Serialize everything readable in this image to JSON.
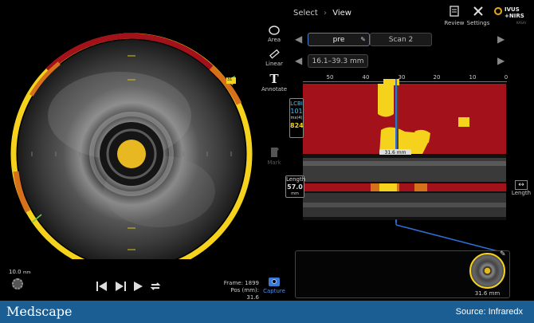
{
  "breadcrumb": {
    "select": "Select",
    "sep": "›",
    "view": "View"
  },
  "top_actions": {
    "review": "Review",
    "settings": "Settings"
  },
  "logo": {
    "line1": "IVUS",
    "line2": "+NIRS",
    "sub": "KASAI"
  },
  "tools": {
    "area": "Area",
    "linear": "Linear",
    "annotate": "Annotate",
    "mark": "Mark"
  },
  "scans": {
    "pre": "pre",
    "scan2": "Scan 2",
    "range": "16.1–39.3 mm"
  },
  "axis": {
    "ticks": [
      "50",
      "40",
      "30",
      "20",
      "10",
      "0"
    ]
  },
  "lcbi": {
    "label": "LCBI",
    "value": "101",
    "mx_label": "mx(4)",
    "mx_value": "824"
  },
  "length": {
    "label": "Length",
    "value": "57.0",
    "unit": "mm",
    "right_label": "Length"
  },
  "cursor": {
    "position": "31.6 mm",
    "ring_tag": "31"
  },
  "ivus": {
    "scale": "10.0",
    "scale_unit": "mm"
  },
  "frame": {
    "frame_label": "Frame:",
    "frame_value": "1899",
    "pos_label": "Pos (mm):",
    "pos_value": "31.6"
  },
  "capture": {
    "label": "Capture"
  },
  "thumbnail": {
    "label": "31.6 mm"
  },
  "footer": {
    "brand": "Medscape",
    "source": "Source:  Infraredx"
  },
  "colors": {
    "footer": "#1a5e93",
    "chemogram_red": "#a3121a",
    "lipid_yellow": "#f5d21b",
    "accent_blue": "#2f6fd6",
    "lcbi_cyan": "#3ec6ff"
  }
}
